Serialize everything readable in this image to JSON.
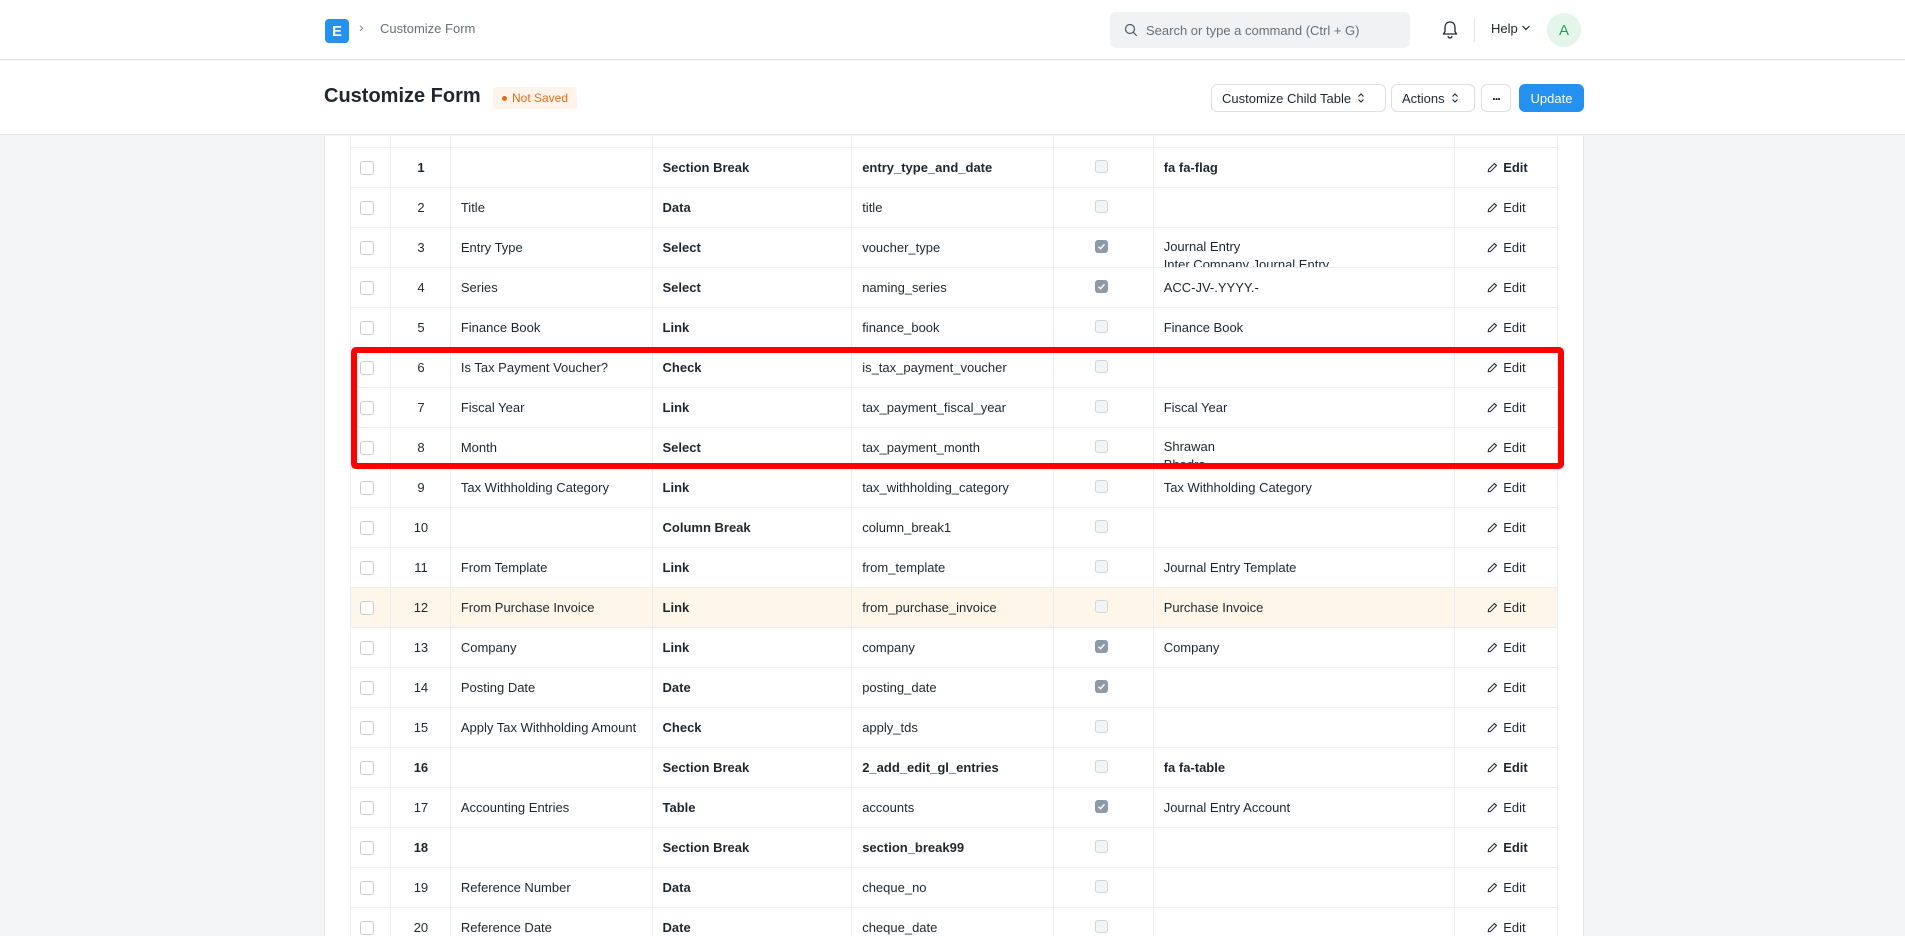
{
  "navbar": {
    "logo_letter": "E",
    "breadcrumb": "Customize Form",
    "search_placeholder": "Search or type a command (Ctrl + G)",
    "help_label": "Help",
    "avatar_letter": "A"
  },
  "header": {
    "title": "Customize Form",
    "status": "Not Saved",
    "buttons": {
      "customize_child_table": "Customize Child Table",
      "actions": "Actions",
      "more": "...",
      "update": "Update"
    }
  },
  "colors": {
    "primary": "#2490ef",
    "highlight_row": "#fef7e9",
    "annotation": "#ff0000",
    "status": "#e86c13"
  },
  "table": {
    "edit_label": "Edit",
    "rows": [
      {
        "no": "1",
        "label": "",
        "type": "Section Break",
        "name": "entry_type_and_date",
        "mandatory": false,
        "options": "fa fa-flag",
        "options2": "",
        "bold": true,
        "highlight": false
      },
      {
        "no": "2",
        "label": "Title",
        "type": "Data",
        "name": "title",
        "mandatory": false,
        "options": "",
        "options2": "",
        "bold": false,
        "highlight": false
      },
      {
        "no": "3",
        "label": "Entry Type",
        "type": "Select",
        "name": "voucher_type",
        "mandatory": true,
        "options": "Journal Entry",
        "options2": "Inter Company Journal Entry",
        "bold": false,
        "highlight": false
      },
      {
        "no": "4",
        "label": "Series",
        "type": "Select",
        "name": "naming_series",
        "mandatory": true,
        "options": "ACC-JV-.YYYY.-",
        "options2": "",
        "bold": false,
        "highlight": false
      },
      {
        "no": "5",
        "label": "Finance Book",
        "type": "Link",
        "name": "finance_book",
        "mandatory": false,
        "options": "Finance Book",
        "options2": "",
        "bold": false,
        "highlight": false
      },
      {
        "no": "6",
        "label": "Is Tax Payment Voucher?",
        "type": "Check",
        "name": "is_tax_payment_voucher",
        "mandatory": false,
        "options": "",
        "options2": "",
        "bold": false,
        "highlight": false
      },
      {
        "no": "7",
        "label": "Fiscal Year",
        "type": "Link",
        "name": "tax_payment_fiscal_year",
        "mandatory": false,
        "options": "Fiscal Year",
        "options2": "",
        "bold": false,
        "highlight": false
      },
      {
        "no": "8",
        "label": "Month",
        "type": "Select",
        "name": "tax_payment_month",
        "mandatory": false,
        "options": "Shrawan",
        "options2": "Bhadra",
        "bold": false,
        "highlight": false
      },
      {
        "no": "9",
        "label": "Tax Withholding Category",
        "type": "Link",
        "name": "tax_withholding_category",
        "mandatory": false,
        "options": "Tax Withholding Category",
        "options2": "",
        "bold": false,
        "highlight": false
      },
      {
        "no": "10",
        "label": "",
        "type": "Column Break",
        "name": "column_break1",
        "mandatory": false,
        "options": "",
        "options2": "",
        "bold": false,
        "highlight": false
      },
      {
        "no": "11",
        "label": "From Template",
        "type": "Link",
        "name": "from_template",
        "mandatory": false,
        "options": "Journal Entry Template",
        "options2": "",
        "bold": false,
        "highlight": false
      },
      {
        "no": "12",
        "label": "From Purchase Invoice",
        "type": "Link",
        "name": "from_purchase_invoice",
        "mandatory": false,
        "options": "Purchase Invoice",
        "options2": "",
        "bold": false,
        "highlight": true
      },
      {
        "no": "13",
        "label": "Company",
        "type": "Link",
        "name": "company",
        "mandatory": true,
        "options": "Company",
        "options2": "",
        "bold": false,
        "highlight": false
      },
      {
        "no": "14",
        "label": "Posting Date",
        "type": "Date",
        "name": "posting_date",
        "mandatory": true,
        "options": "",
        "options2": "",
        "bold": false,
        "highlight": false
      },
      {
        "no": "15",
        "label": "Apply Tax Withholding Amount",
        "type": "Check",
        "name": "apply_tds",
        "mandatory": false,
        "options": "",
        "options2": "",
        "bold": false,
        "highlight": false
      },
      {
        "no": "16",
        "label": "",
        "type": "Section Break",
        "name": "2_add_edit_gl_entries",
        "mandatory": false,
        "options": "fa fa-table",
        "options2": "",
        "bold": true,
        "highlight": false
      },
      {
        "no": "17",
        "label": "Accounting Entries",
        "type": "Table",
        "name": "accounts",
        "mandatory": true,
        "options": "Journal Entry Account",
        "options2": "",
        "bold": false,
        "highlight": false
      },
      {
        "no": "18",
        "label": "",
        "type": "Section Break",
        "name": "section_break99",
        "mandatory": false,
        "options": "",
        "options2": "",
        "bold": true,
        "highlight": false
      },
      {
        "no": "19",
        "label": "Reference Number",
        "type": "Data",
        "name": "cheque_no",
        "mandatory": false,
        "options": "",
        "options2": "",
        "bold": false,
        "highlight": false
      },
      {
        "no": "20",
        "label": "Reference Date",
        "type": "Date",
        "name": "cheque_date",
        "mandatory": false,
        "options": "",
        "options2": "",
        "bold": false,
        "highlight": false
      }
    ]
  }
}
